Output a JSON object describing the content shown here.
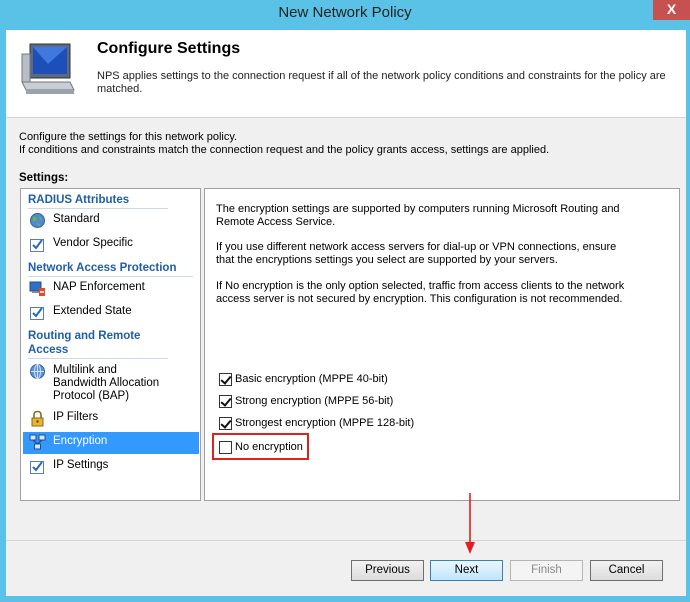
{
  "window": {
    "title": "New Network Policy",
    "close_label": "X"
  },
  "header": {
    "title": "Configure Settings",
    "description": "NPS applies settings to the connection request if all of the network policy conditions and constraints for the policy are matched."
  },
  "intro": {
    "line1": "Configure the settings for this network policy.",
    "line2": "If conditions and constraints match the connection request and the policy grants access, settings are applied."
  },
  "settings_label": "Settings:",
  "sidebar": {
    "groups": [
      {
        "title": "RADIUS Attributes",
        "items": [
          {
            "label": "Standard",
            "icon": "globe-icon"
          },
          {
            "label": "Vendor Specific",
            "icon": "checklist-icon"
          }
        ]
      },
      {
        "title": "Network Access Protection",
        "items": [
          {
            "label": "NAP Enforcement",
            "icon": "nap-icon"
          },
          {
            "label": "Extended State",
            "icon": "checklist-icon"
          }
        ]
      },
      {
        "title": "Routing and Remote Access",
        "items": [
          {
            "label": "Multilink and Bandwidth Allocation Protocol (BAP)",
            "icon": "network-icon"
          },
          {
            "label": "IP Filters",
            "icon": "lock-icon"
          },
          {
            "label": "Encryption",
            "icon": "encryption-icon",
            "selected": true
          },
          {
            "label": "IP Settings",
            "icon": "checklist-icon"
          }
        ]
      }
    ]
  },
  "content": {
    "para1": "The encryption settings are supported by computers running Microsoft Routing and Remote Access Service.",
    "para2": "If you use different network access servers for dial-up or VPN connections, ensure that the encryptions settings you select are supported by your servers.",
    "para3": "If No encryption is the only option selected, traffic from access clients to the network access server is not secured by encryption. This configuration is not recommended.",
    "options": [
      {
        "label": "Basic encryption (MPPE 40-bit)",
        "checked": true
      },
      {
        "label": "Strong encryption (MPPE 56-bit)",
        "checked": true
      },
      {
        "label": "Strongest encryption (MPPE 128-bit)",
        "checked": true
      },
      {
        "label": "No encryption",
        "checked": false
      }
    ]
  },
  "buttons": {
    "previous": "Previous",
    "next": "Next",
    "finish": "Finish",
    "cancel": "Cancel"
  },
  "colors": {
    "titlebar": "#5bc2e7",
    "selection": "#3399ff",
    "highlight": "#d9231c",
    "group_heading": "#1f5fa8"
  }
}
